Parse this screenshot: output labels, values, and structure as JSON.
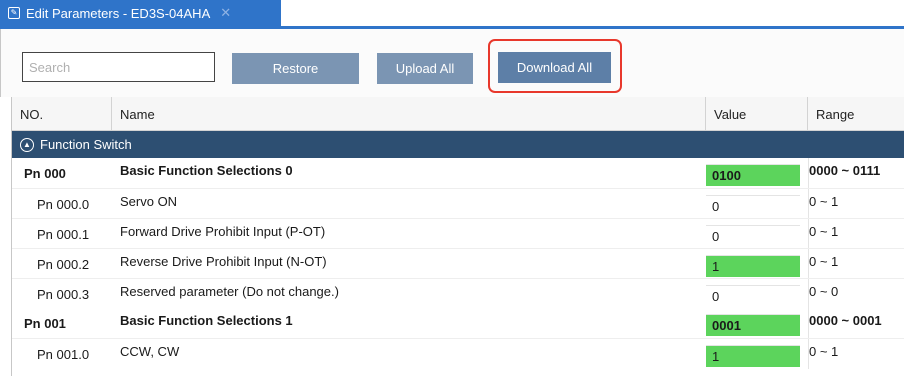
{
  "tab": {
    "icon": "edit-document-icon",
    "title": "Edit Parameters - ED3S-04AHA",
    "close": "✕"
  },
  "toolbar": {
    "search_placeholder": "Search",
    "search_value": "",
    "restore_label": "Restore",
    "upload_label": "Upload All",
    "download_label": "Download All"
  },
  "grid": {
    "columns": {
      "no": "NO.",
      "name": "Name",
      "value": "Value",
      "range": "Range"
    },
    "group": {
      "icon": "circle-chevron-up-icon",
      "label": "Function Switch"
    },
    "rows": [
      {
        "no": "Pn 000",
        "name": "Basic Function Selections 0",
        "value": "0100",
        "range": "0000 ~ 0111",
        "main": true,
        "highlighted": true
      },
      {
        "no": "Pn 000.0",
        "name": "Servo ON",
        "value": "0",
        "range": "0 ~ 1",
        "main": false,
        "highlighted": false
      },
      {
        "no": "Pn 000.1",
        "name": "Forward Drive Prohibit Input (P-OT)",
        "value": "0",
        "range": "0 ~ 1",
        "main": false,
        "highlighted": false
      },
      {
        "no": "Pn 000.2",
        "name": "Reverse Drive Prohibit Input (N-OT)",
        "value": "1",
        "range": "0 ~ 1",
        "main": false,
        "highlighted": true
      },
      {
        "no": "Pn 000.3",
        "name": "Reserved parameter (Do not change.)",
        "value": "0",
        "range": "0 ~ 0",
        "main": false,
        "highlighted": false
      },
      {
        "no": "Pn 001",
        "name": "Basic Function Selections 1",
        "value": "0001",
        "range": "0000 ~ 0001",
        "main": true,
        "highlighted": true
      },
      {
        "no": "Pn 001.0",
        "name": "CCW, CW",
        "value": "1",
        "range": "0 ~ 1",
        "main": false,
        "highlighted": true
      }
    ]
  },
  "colors": {
    "tab_blue": "#2f74c9",
    "button": "#7b95b3",
    "group_header": "#2d4f72",
    "value_highlight": "#5cd45c",
    "callout_red": "#e8382c"
  }
}
